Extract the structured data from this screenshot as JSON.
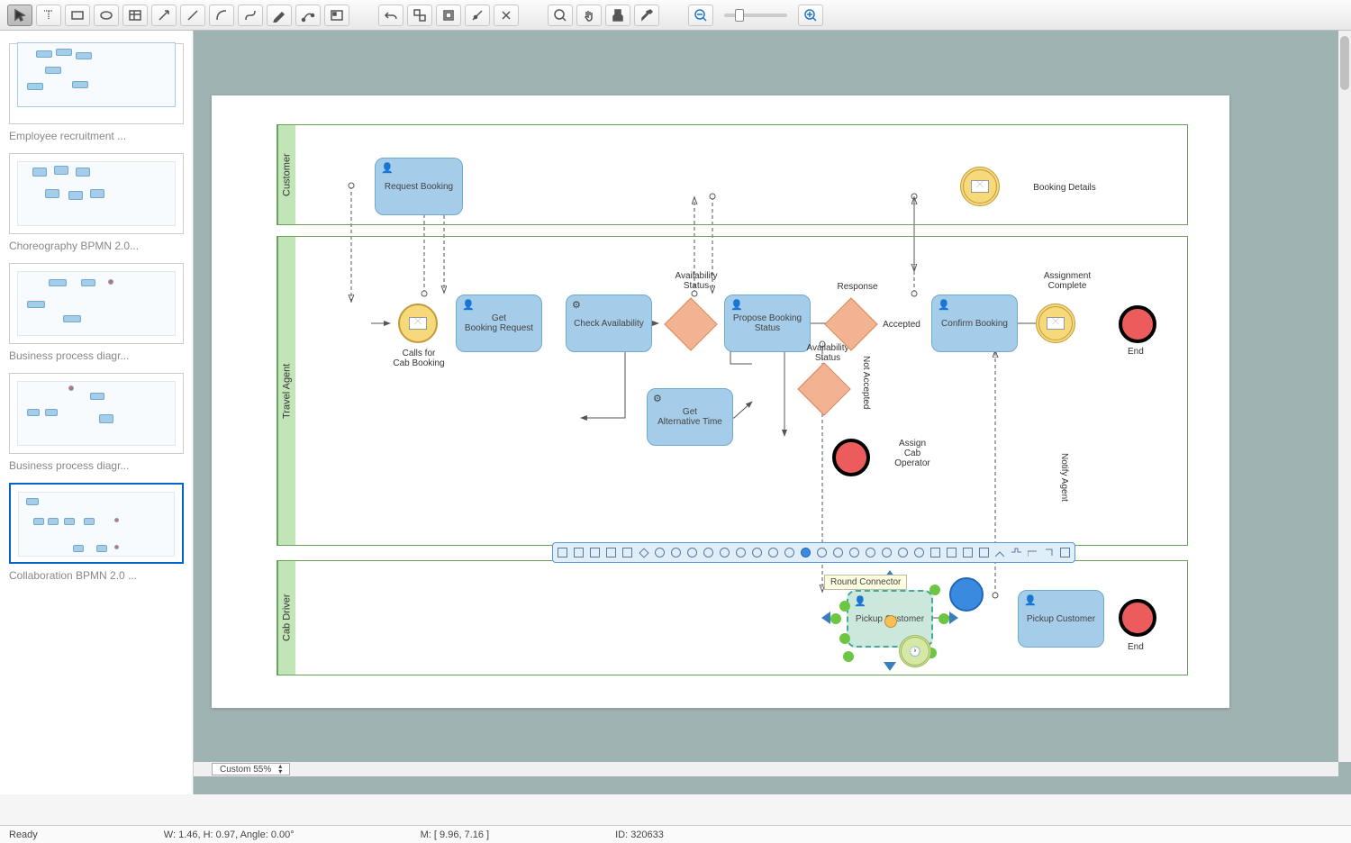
{
  "toolbar": {
    "tools": [
      "select",
      "text",
      "rect",
      "ellipse",
      "table",
      "arrow",
      "line",
      "curve",
      "bezier",
      "pen",
      "edit-points",
      "library"
    ],
    "edit": [
      "undo",
      "ungroup",
      "group",
      "align",
      "snap"
    ],
    "nav": [
      "zoom-tool",
      "pan",
      "stamp",
      "eyedropper"
    ],
    "zoom": [
      "zoom-out",
      "zoom-slider",
      "zoom-in"
    ]
  },
  "thumbnails": [
    {
      "label": "Employee recruitment ..."
    },
    {
      "label": "Choreography BPMN 2.0..."
    },
    {
      "label": "Business process diagr..."
    },
    {
      "label": "Business process diagr..."
    },
    {
      "label": "Collaboration BPMN 2.0 ...",
      "selected": true
    }
  ],
  "zoom_box": "Custom 55%",
  "status": {
    "ready": "Ready",
    "dims": "W: 1.46,  H: 0.97,  Angle: 0.00°",
    "mouse": "M: [ 9.96, 7.16 ]",
    "id": "ID: 320633"
  },
  "pools": {
    "customer": "Customer",
    "agent": "Travel Agent",
    "driver": "Cab Driver"
  },
  "tasks": {
    "request": "Request Booking",
    "get_req": "Get\nBooking Request",
    "check": "Check Availability",
    "propose": "Propose Booking Status",
    "alt": "Get\nAlternative Time",
    "confirm": "Confirm Booking",
    "pickup1": "Pickup Customer",
    "pickup2": "Pickup Customer"
  },
  "labels": {
    "booking_details": "Booking Details",
    "calls": "Calls for\nCab Booking",
    "avail_status": "Availability\nStatus",
    "response": "Response",
    "accepted": "Accepted",
    "avail_status2": "Availability\nStatus",
    "not_accepted": "Not Accepted",
    "assign": "Assign\nCab\nOperator",
    "assignment_complete": "Assignment\nComplete",
    "notify": "Notify Agent",
    "end1": "End",
    "end2": "End"
  },
  "tooltip": "Round Connector"
}
